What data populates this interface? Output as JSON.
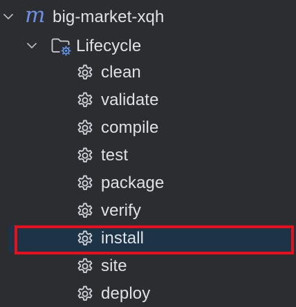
{
  "project": {
    "name": "big-market-xqh",
    "icon": "maven-m-icon",
    "icon_glyph": "m",
    "icon_color": "#6e8fe8"
  },
  "lifecycle": {
    "label": "Lifecycle",
    "icon": "lifecycle-folder-icon"
  },
  "goals": [
    {
      "label": "clean"
    },
    {
      "label": "validate"
    },
    {
      "label": "compile"
    },
    {
      "label": "test"
    },
    {
      "label": "package"
    },
    {
      "label": "verify"
    },
    {
      "label": "install",
      "selected": true
    },
    {
      "label": "site"
    },
    {
      "label": "deploy"
    }
  ],
  "colors": {
    "background": "#2b2d30",
    "selection": "#1d3446",
    "highlight_border": "#e8101a",
    "text": "#dfe1e5"
  }
}
